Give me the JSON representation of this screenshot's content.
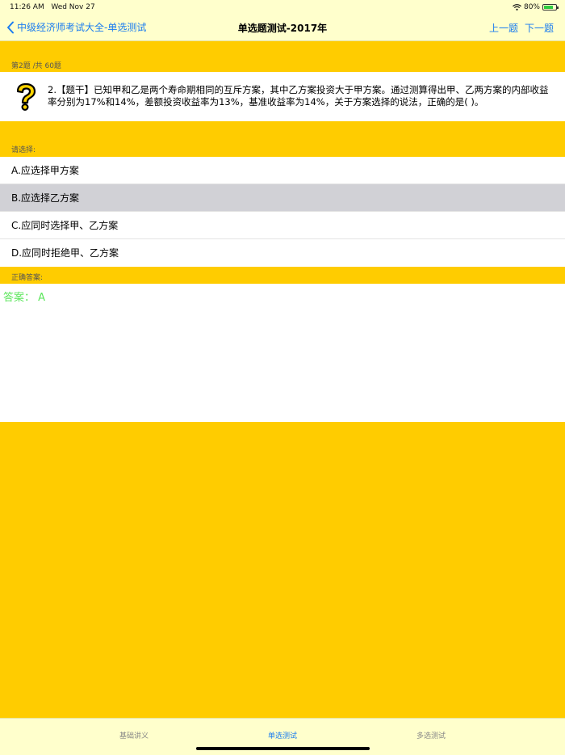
{
  "status_bar": {
    "time": "11:26 AM",
    "date": "Wed Nov 27",
    "battery": "80%",
    "battery_level": 0.8,
    "icons": [
      "wifi-icon",
      "battery-icon"
    ]
  },
  "nav": {
    "back_label": "中级经济师考试大全-单选测试",
    "title": "单选题测试-2017年",
    "prev_label": "上一题",
    "next_label": "下一题"
  },
  "question": {
    "progress": "第2题 /共 60题",
    "icon": "question-mark-icon",
    "text": "2.【题干】已知甲和乙是两个寿命期相同的互斥方案，其中乙方案投资大于甲方案。通过测算得出甲、乙两方案的内部收益率分别为17%和14%，差额投资收益率为13%，基准收益率为14%，关于方案选择的说法，正确的是(   )。"
  },
  "options_header": "请选择:",
  "options": [
    {
      "label": "A.应选择甲方案",
      "selected": false
    },
    {
      "label": "B.应选择乙方案",
      "selected": true
    },
    {
      "label": "C.应同时选择甲、乙方案",
      "selected": false
    },
    {
      "label": "D.应同时拒绝甲、乙方案",
      "selected": false
    }
  ],
  "answer": {
    "header": "正确答案:",
    "text": "答案：  A"
  },
  "tabs": [
    {
      "label": "基础讲义",
      "active": false
    },
    {
      "label": "单选测试",
      "active": true
    },
    {
      "label": "多选测试",
      "active": false
    }
  ],
  "colors": {
    "background": "#FFCC00",
    "bar": "#FFFFCC",
    "accent": "#1A7CF0",
    "answer": "#5CE65C",
    "selected_row": "#D1D1D6"
  }
}
